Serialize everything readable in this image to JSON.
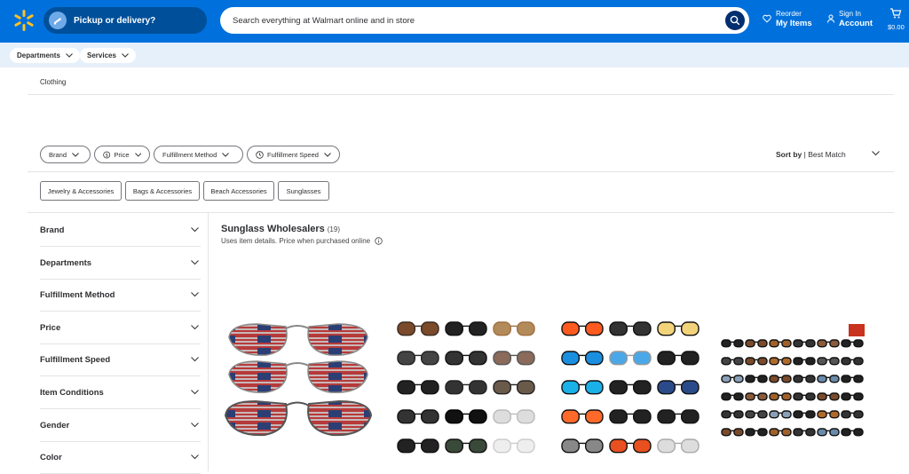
{
  "header": {
    "pickup_label": "Pickup or delivery?",
    "search_placeholder": "Search everything at Walmart online and in store",
    "reorder_small": "Reorder",
    "reorder_big": "My Items",
    "signin_small": "Sign In",
    "signin_big": "Account",
    "cart_total": "$0.00"
  },
  "subnav": {
    "departments": "Departments",
    "services": "Services"
  },
  "breadcrumb": "Clothing",
  "filters": [
    "Brand",
    "Price",
    "Fulfillment Method",
    "Fulfillment Speed"
  ],
  "sort": {
    "label": "Sort by",
    "value": "Best Match"
  },
  "categories": [
    "Jewelry & Accessories",
    "Bags & Accessories",
    "Beach Accessories",
    "Sunglasses"
  ],
  "sidebar": [
    "Brand",
    "Departments",
    "Fulfillment Method",
    "Price",
    "Fulfillment Speed",
    "Item Conditions",
    "Gender",
    "Color"
  ],
  "section": {
    "title": "Sunglass Wholesalers",
    "count": "(19)",
    "subtitle": "Uses item details. Price when purchased online"
  },
  "colors": {
    "brand_blue": "#0071dc",
    "dark_blue": "#004f9a",
    "spark": "#ffc220"
  }
}
